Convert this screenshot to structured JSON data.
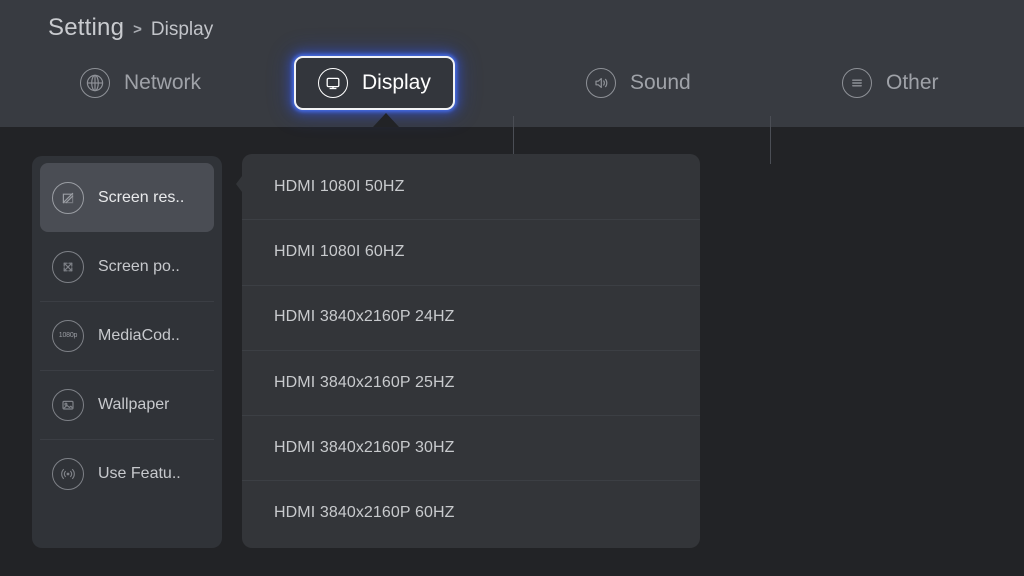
{
  "colors": {
    "header_bg": "#383b41",
    "body_bg": "#222326",
    "card_bg": "#303338",
    "panel_bg": "#333539",
    "selected_bg": "#4a4d54",
    "focus_ring": "#ffffff",
    "focus_glow": "#3c63d8",
    "text_primary": "#c8cacd",
    "text_muted": "#9fa2a8"
  },
  "breadcrumb": {
    "root": "Setting",
    "separator": ">",
    "leaf": "Display"
  },
  "tabs": [
    {
      "id": "network",
      "label": "Network",
      "icon": "globe-icon",
      "active": false
    },
    {
      "id": "display",
      "label": "Display",
      "icon": "monitor-icon",
      "active": true
    },
    {
      "id": "sound",
      "label": "Sound",
      "icon": "speaker-icon",
      "active": false
    },
    {
      "id": "other",
      "label": "Other",
      "icon": "list-menu-icon",
      "active": false
    }
  ],
  "sidebar": {
    "items": [
      {
        "id": "screen-resolution",
        "label": "Screen res..",
        "icon": "screen-resolution-icon",
        "selected": true
      },
      {
        "id": "screen-position",
        "label": "Screen po..",
        "icon": "expand-arrows-icon",
        "selected": false
      },
      {
        "id": "media-codec",
        "label": "MediaCod..",
        "icon": "1080p-icon",
        "selected": false,
        "badge": "1080p"
      },
      {
        "id": "wallpaper",
        "label": "Wallpaper",
        "icon": "image-icon",
        "selected": false
      },
      {
        "id": "use-feature",
        "label": "Use Featu..",
        "icon": "signal-waves-icon",
        "selected": false
      }
    ]
  },
  "options": {
    "items": [
      {
        "id": "hdmi-1080i-50hz",
        "label": "HDMI 1080I 50HZ"
      },
      {
        "id": "hdmi-1080i-60hz",
        "label": "HDMI 1080I 60HZ"
      },
      {
        "id": "hdmi-3840x2160p-24hz",
        "label": "HDMI 3840x2160P 24HZ"
      },
      {
        "id": "hdmi-3840x2160p-25hz",
        "label": "HDMI 3840x2160P 25HZ"
      },
      {
        "id": "hdmi-3840x2160p-30hz",
        "label": "HDMI 3840x2160P 30HZ"
      },
      {
        "id": "hdmi-3840x2160p-60hz",
        "label": "HDMI 3840x2160P 60HZ"
      }
    ]
  }
}
